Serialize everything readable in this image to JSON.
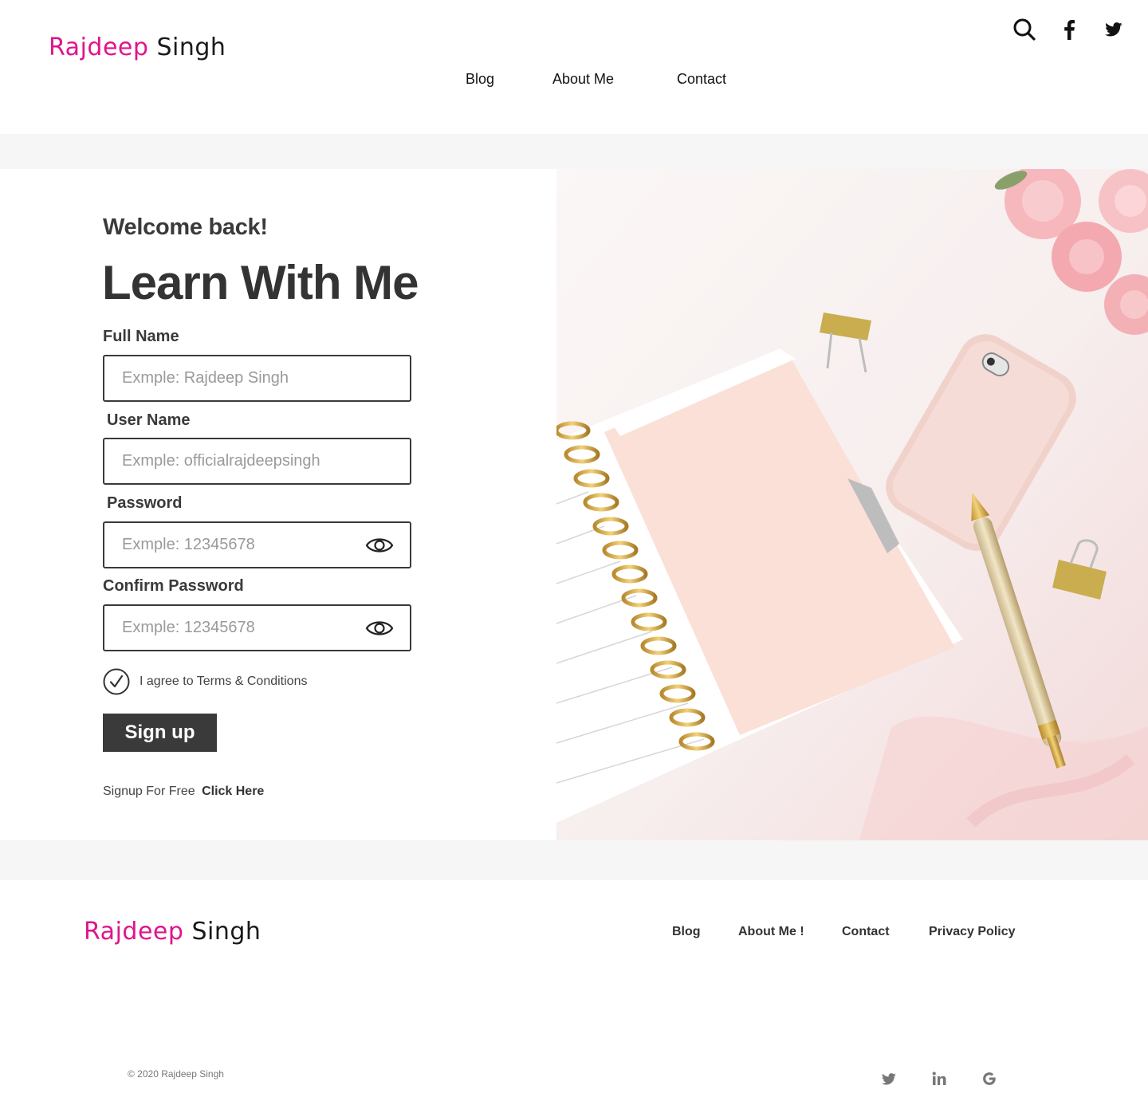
{
  "brand": {
    "first": "Rajdeep",
    "last": "Singh"
  },
  "nav": [
    {
      "label": "Blog"
    },
    {
      "label": "About Me"
    },
    {
      "label": "Contact"
    }
  ],
  "top_icons": [
    "search-icon",
    "facebook-icon",
    "twitter-icon"
  ],
  "form": {
    "welcome": "Welcome back!",
    "headline": "Learn With Me",
    "full_name": {
      "label": "Full Name",
      "placeholder": "Exmple: Rajdeep Singh"
    },
    "user_name": {
      "label": "User Name",
      "placeholder": "Exmple: officialrajdeepsingh"
    },
    "password": {
      "label": "Password",
      "placeholder": "Exmple: 12345678"
    },
    "confirm_password": {
      "label": "Confirm Password",
      "placeholder": "Exmple: 12345678"
    },
    "agree_text": "I agree to Terms & Conditions",
    "agree_checked": true,
    "submit_label": "Sign up",
    "free_text": "Signup For Free",
    "free_link": "Click Here"
  },
  "footer": {
    "nav": [
      {
        "label": "Blog"
      },
      {
        "label": "About Me !"
      },
      {
        "label": "Contact"
      },
      {
        "label": "Privacy Policy"
      }
    ],
    "copyright": "© 2020 Rajdeep Singh",
    "social": [
      "twitter-icon",
      "linkedin-icon",
      "google-icon"
    ]
  },
  "colors": {
    "brand_accent": "#e0148c",
    "dark": "#3a3a3a",
    "band": "#f6f6f6"
  }
}
